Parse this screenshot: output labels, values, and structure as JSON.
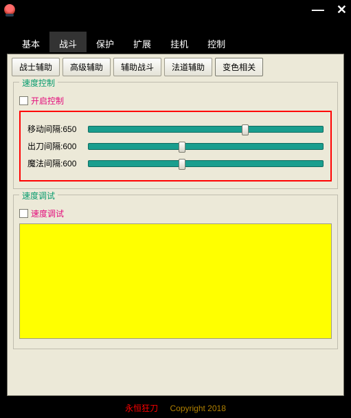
{
  "menubar": {
    "items": [
      "基本",
      "战斗",
      "保护",
      "扩展",
      "挂机",
      "控制"
    ],
    "active_index": 1
  },
  "subtabs": {
    "items": [
      "战士辅助",
      "高级辅助",
      "辅助战斗",
      "法道辅助",
      "变色相关"
    ],
    "active_index": 4
  },
  "speed_control": {
    "legend": "速度控制",
    "checkbox_label": "开启控制",
    "sliders": [
      {
        "label": "移动间隔:",
        "value": 650,
        "pos_pct": 67
      },
      {
        "label": "出刀间隔:",
        "value": 600,
        "pos_pct": 40
      },
      {
        "label": "魔法间隔:",
        "value": 600,
        "pos_pct": 40
      }
    ]
  },
  "speed_test": {
    "legend": "速度调试",
    "checkbox_label": "速度调试"
  },
  "footer": {
    "brand": "永恒狂刀",
    "copyright": "Copyright 2018"
  }
}
